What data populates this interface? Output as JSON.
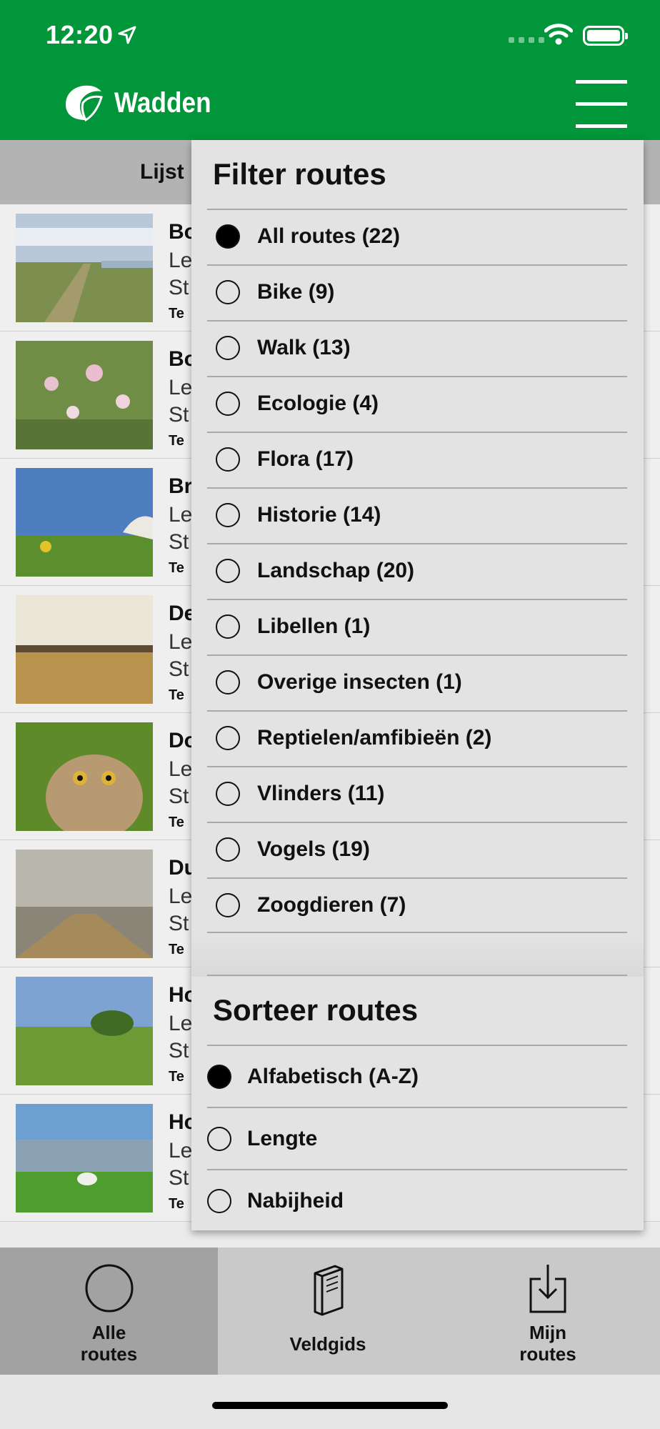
{
  "status": {
    "time": "12:20"
  },
  "header": {
    "title": "Wadden"
  },
  "subheader": {
    "text": "Lijst"
  },
  "routes": [
    {
      "name": "Bo",
      "l1": "Le",
      "l2": "St",
      "l3": "Te"
    },
    {
      "name": "Bo",
      "l1": "Le",
      "l2": "St",
      "l3": "Te"
    },
    {
      "name": "Br",
      "l1": "Le",
      "l2": "St",
      "l3": "Te"
    },
    {
      "name": "De",
      "l1": "Le",
      "l2": "St",
      "l3": "Te"
    },
    {
      "name": "Do",
      "l1": "Le",
      "l2": "St",
      "l3": "Te"
    },
    {
      "name": "Du",
      "l1": "Le",
      "l2": "St",
      "l3": "Te"
    },
    {
      "name": "Ho",
      "l1": "Le",
      "l2": "St",
      "l3": "Te"
    },
    {
      "name": "Ho",
      "l1": "Le",
      "l2": "St",
      "l3": "Te"
    }
  ],
  "filter": {
    "title": "Filter routes",
    "options": [
      {
        "label": "All routes (22)",
        "selected": true
      },
      {
        "label": "Bike (9)",
        "selected": false
      },
      {
        "label": "Walk (13)",
        "selected": false
      },
      {
        "label": "Ecologie (4)",
        "selected": false
      },
      {
        "label": "Flora (17)",
        "selected": false
      },
      {
        "label": "Historie (14)",
        "selected": false
      },
      {
        "label": "Landschap (20)",
        "selected": false
      },
      {
        "label": "Libellen (1)",
        "selected": false
      },
      {
        "label": "Overige insecten (1)",
        "selected": false
      },
      {
        "label": "Reptielen/amfibieën (2)",
        "selected": false
      },
      {
        "label": "Vlinders (11)",
        "selected": false
      },
      {
        "label": "Vogels (19)",
        "selected": false
      },
      {
        "label": "Zoogdieren (7)",
        "selected": false
      }
    ]
  },
  "sort": {
    "title": "Sorteer routes",
    "options": [
      {
        "label": "Alfabetisch (A-Z)",
        "selected": true
      },
      {
        "label": "Lengte",
        "selected": false
      },
      {
        "label": "Nabijheid",
        "selected": false
      }
    ]
  },
  "tabs": [
    {
      "label": "Alle\nroutes",
      "icon": "circle-icon",
      "active": true
    },
    {
      "label": "Veldgids",
      "icon": "book-icon",
      "active": false
    },
    {
      "label": "Mijn\nroutes",
      "icon": "download-icon",
      "active": false
    }
  ],
  "colors": {
    "brand_green": "#009639",
    "tab_active": "#a2a2a2"
  }
}
